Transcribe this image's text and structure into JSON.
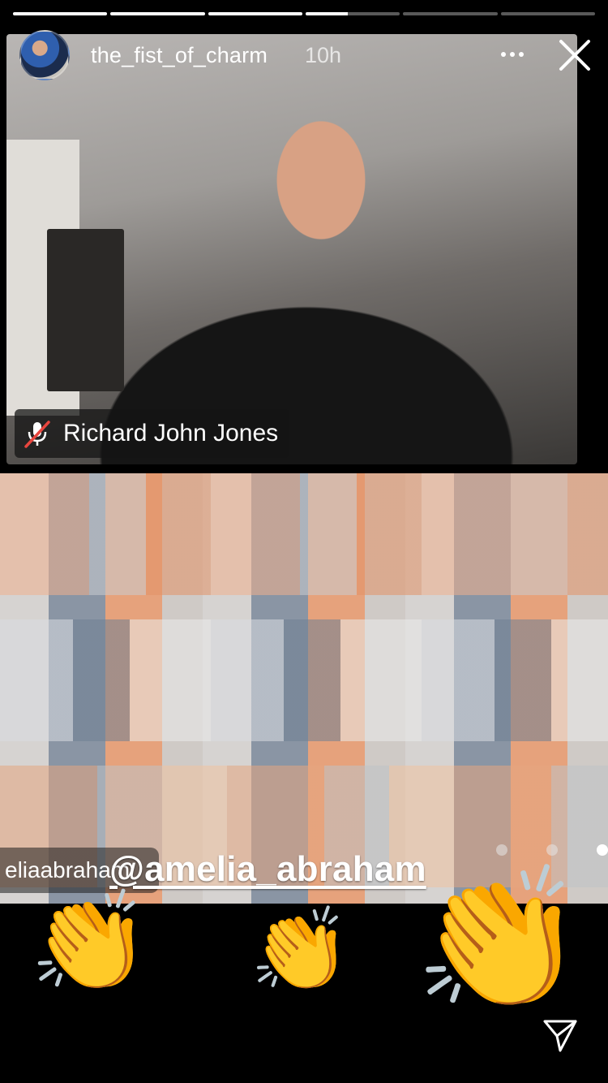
{
  "story": {
    "username": "the_fist_of_charm",
    "time_ago": "10h",
    "progress_segments": [
      1,
      1,
      1,
      0.45,
      0,
      0
    ]
  },
  "video": {
    "top_participant_name": "Richard John Jones",
    "bottom_name_partial": "eliaabraham",
    "mention": "@amelia_abraham"
  },
  "stickers": {
    "emoji": "👏"
  },
  "colors": {
    "background": "#000000",
    "emoji_yellow": "#f7c318"
  },
  "icons": [
    "more-options-icon",
    "close-icon",
    "mic-muted-icon",
    "send-icon",
    "clapping-hands-icon"
  ]
}
